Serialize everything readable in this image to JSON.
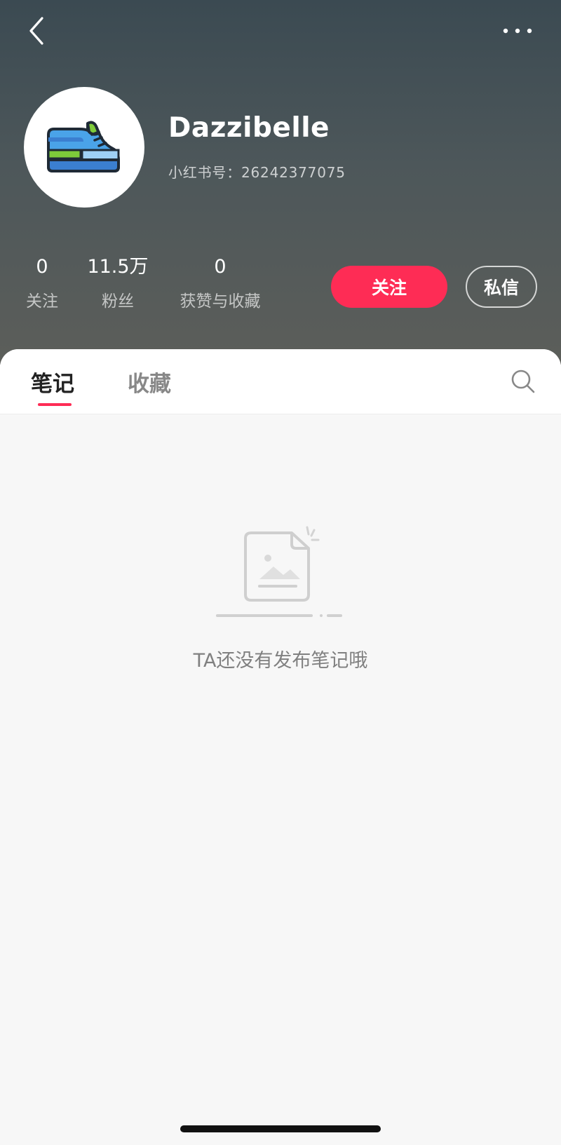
{
  "header": {
    "back_icon": "chevron-left-icon",
    "more_icon": "ellipsis-horizontal-icon"
  },
  "profile": {
    "avatar_icon": "sneaker-icon",
    "name": "Dazzibelle",
    "account_id": "小红书号：26242377075",
    "stats": [
      {
        "value": "0",
        "label": "关注"
      },
      {
        "value": "11.5万",
        "label": "粉丝"
      },
      {
        "value": "0",
        "label": "获赞与收藏"
      }
    ],
    "follow_label": "关注",
    "message_label": "私信"
  },
  "tabs": [
    {
      "label": "笔记",
      "active": true
    },
    {
      "label": "收藏",
      "active": false
    }
  ],
  "search_icon": "search-icon",
  "empty_state": {
    "icon": "empty-note-icon",
    "text": "TA还没有发布笔记哦"
  },
  "colors": {
    "accent": "#fe2c55",
    "header_top": "#3b4a52",
    "header_bottom": "#5c5e5a"
  }
}
